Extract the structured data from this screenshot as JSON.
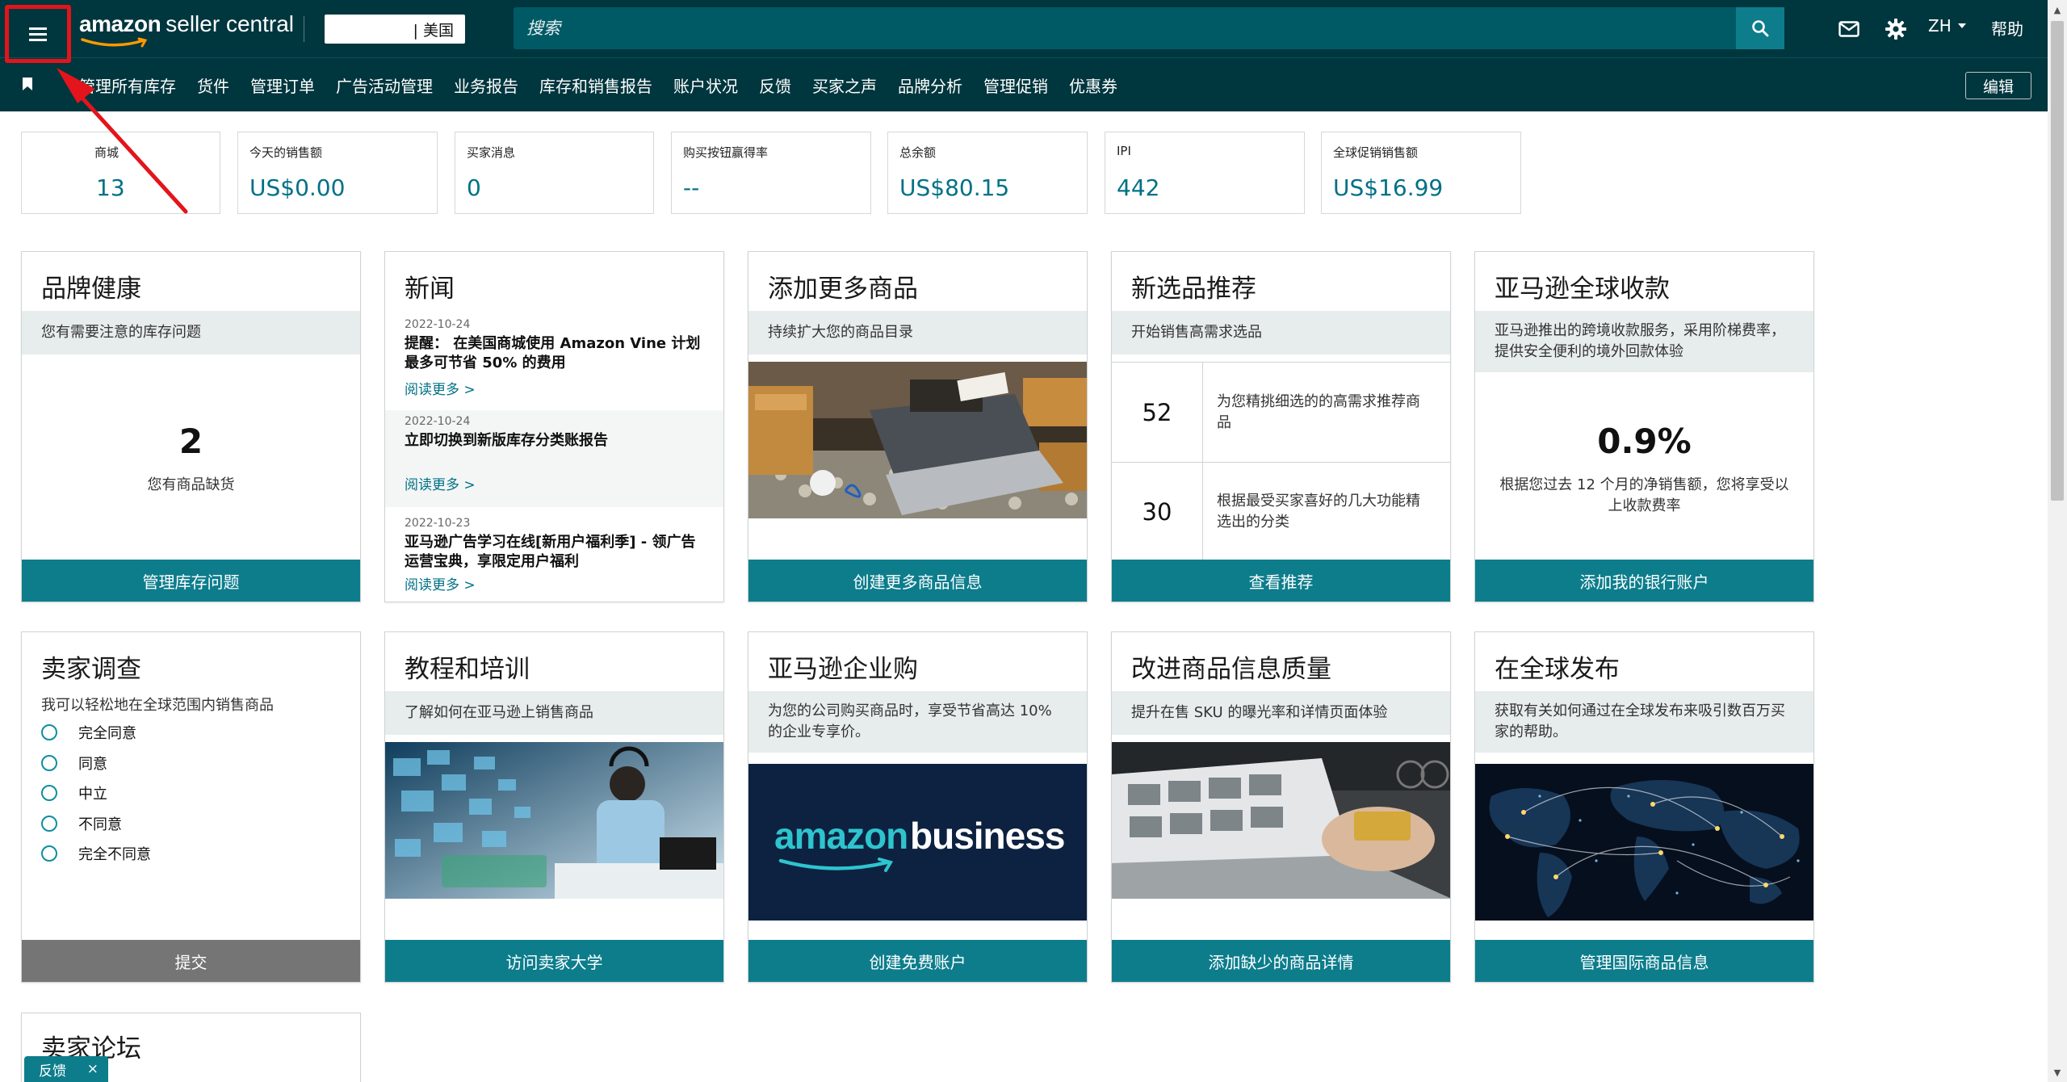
{
  "header": {
    "logo_word": "amazon",
    "logo_suffix": "seller central",
    "marketplace": "| 美国",
    "search_placeholder": "搜索",
    "language": "ZH",
    "help": "帮助"
  },
  "nav": {
    "items": [
      "管理所有库存",
      "货件",
      "管理订单",
      "广告活动管理",
      "业务报告",
      "库存和销售报告",
      "账户状况",
      "反馈",
      "买家之声",
      "品牌分析",
      "管理促销",
      "优惠券"
    ],
    "edit": "编辑"
  },
  "metrics": [
    {
      "label": "商城",
      "value": "13"
    },
    {
      "label": "今天的销售额",
      "value": "US$0.00"
    },
    {
      "label": "买家消息",
      "value": "0"
    },
    {
      "label": "购买按钮赢得率",
      "value": "--"
    },
    {
      "label": "总余额",
      "value": "US$80.15"
    },
    {
      "label": "IPI",
      "value": "442"
    },
    {
      "label": "全球促销销售额",
      "value": "US$16.99"
    }
  ],
  "cards": {
    "brand_health": {
      "title": "品牌健康",
      "sub": "您有需要注意的库存问题",
      "number": "2",
      "caption": "您有商品缺货",
      "button": "管理库存问题"
    },
    "news": {
      "title": "新闻",
      "items": [
        {
          "date": "2022-10-24",
          "headline": "提醒： 在美国商城使用 Amazon Vine 计划最多可节省 50% 的费用",
          "more": "阅读更多 >"
        },
        {
          "date": "2022-10-24",
          "headline": "立即切换到新版库存分类账报告",
          "more": "阅读更多 >"
        },
        {
          "date": "2022-10-23",
          "headline": "亚马逊广告学习在线[新用户福利季] - 领广告运营宝典，享限定用户福利",
          "more": "阅读更多 >"
        }
      ]
    },
    "add_products": {
      "title": "添加更多商品",
      "sub": "持续扩大您的商品目录",
      "button": "创建更多商品信息"
    },
    "recommend": {
      "title": "新选品推荐",
      "sub": "开始销售高需求选品",
      "rows": [
        {
          "number": "52",
          "text": "为您精挑细选的的高需求推荐商品"
        },
        {
          "number": "30",
          "text": "根据最受买家喜好的几大功能精选出的分类"
        }
      ],
      "button": "查看推荐"
    },
    "payments": {
      "title": "亚马逊全球收款",
      "sub": "亚马逊推出的跨境收款服务，采用阶梯费率，提供安全便利的境外回款体验",
      "number": "0.9%",
      "caption": "根据您过去 12 个月的净销售额，您将享受以上收款费率",
      "button": "添加我的银行账户"
    },
    "survey": {
      "title": "卖家调查",
      "question": "我可以轻松地在全球范围内销售商品",
      "options": [
        "完全同意",
        "同意",
        "中立",
        "不同意",
        "完全不同意"
      ],
      "button": "提交"
    },
    "training": {
      "title": "教程和培训",
      "sub": "了解如何在亚马逊上销售商品",
      "button": "访问卖家大学"
    },
    "business": {
      "title": "亚马逊企业购",
      "sub": "为您的公司购买商品时，享受节省高达 10% 的企业专享价。",
      "logo_word1": "amazon",
      "logo_word2": "business",
      "button": "创建免费账户"
    },
    "quality": {
      "title": "改进商品信息质量",
      "sub": "提升在售 SKU 的曝光率和详情页面体验",
      "button": "添加缺少的商品详情"
    },
    "global": {
      "title": "在全球发布",
      "sub": "获取有关如何通过在全球发布来吸引数百万买家的帮助。",
      "button": "管理国际商品信息"
    },
    "forum": {
      "title": "卖家论坛"
    }
  },
  "feedback": {
    "label": "反馈",
    "close": "×"
  },
  "icons": {
    "menu": "menu-icon",
    "search": "search-icon",
    "mail": "mail-icon",
    "settings": "gear-icon",
    "bookmark": "bookmark-icon"
  },
  "colors": {
    "header_bg": "#00363e",
    "search_bg": "#005a66",
    "accent": "#0d7d8c",
    "link": "#007185",
    "highlight": "#e3141b"
  }
}
